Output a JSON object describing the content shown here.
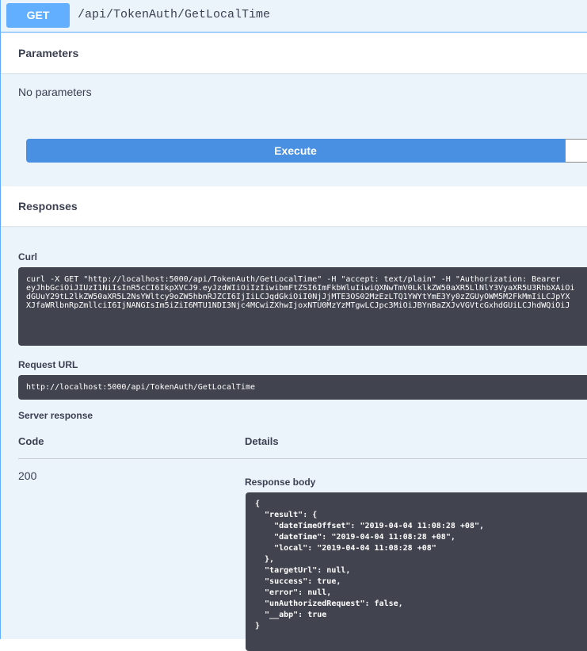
{
  "operation": {
    "method": "GET",
    "path": "/api/TokenAuth/GetLocalTime"
  },
  "parameters": {
    "title": "Parameters",
    "empty_text": "No parameters"
  },
  "execute_label": "Execute",
  "responses": {
    "title": "Responses",
    "curl_label": "Curl",
    "curl_lines": [
      "curl -X GET \"http://localhost:5000/api/TokenAuth/GetLocalTime\" -H \"accept: text/plain\" -H \"Authorization: Bearer",
      "eyJhbGciOiJIUzI1NiIsInR5cCI6IkpXVCJ9.eyJzdWIiOiIzIiwibmFtZSI6ImFkbWluIiwiQXNwTmV0LklkZW50aXR5LlNlY3VyaXR5U3RhbXAiOi",
      "dGUuY29tL2lkZW50aXR5L2NsYWltcy9oZW5hbnRJZCI6IjIiLCJqdGkiOiI0NjJjMTE3OS02MzEzLTQ1YWYtYmE3Yy0zZGUyOWM5M2FkMmIiLCJpYX",
      "XJfaWRlbnRpZmllciI6IjNANGIsIm5iZiI6MTU1NDI3Njc4MCwiZXhwIjoxNTU0MzYzMTgwLCJpc3MiOiJBYnBaZXJvVGVtcGxhdGUiLCJhdWQiOiJ"
    ],
    "request_url_label": "Request URL",
    "request_url": "http://localhost:5000/api/TokenAuth/GetLocalTime",
    "server_response_label": "Server response",
    "code_header": "Code",
    "details_header": "Details",
    "code_value": "200",
    "response_body_label": "Response body",
    "body_lines": [
      "{",
      "  \"result\": {",
      "    \"dateTimeOffset\": \"2019-04-04 11:08:28 +08\",",
      "    \"dateTime\": \"2019-04-04 11:08:28 +08\",",
      "    \"local\": \"2019-04-04 11:08:28 +08\"",
      "  },",
      "  \"targetUrl\": null,",
      "  \"success\": true,",
      "  \"error\": null,",
      "  \"unAuthorizedRequest\": false,",
      "  \"__abp\": true",
      "}"
    ]
  },
  "colors": {
    "method_get": "#61affe",
    "execute": "#4990e2",
    "code_bg": "#41444e",
    "block_bg": "#ebf3fb"
  }
}
